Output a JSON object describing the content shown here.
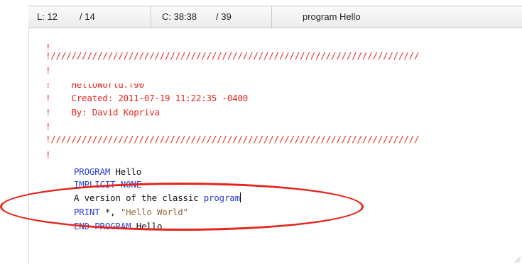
{
  "status_bar": {
    "line_label": "L: 12",
    "line_total": "/ 14",
    "col_label": "C: 38:38",
    "col_total": "/ 39",
    "symbol": "program Hello"
  },
  "editor": {
    "lines": {
      "l1": "!",
      "l2": "!///////////////////////////////////////////////////////////////////////",
      "l3": "!",
      "l4": "!    HelloWorld.f90",
      "l5": "!    Created: 2011-07-19 11:22:35 -0400",
      "l6": "!    By: David Kopriva",
      "l7": "!",
      "l8": "!///////////////////////////////////////////////////////////////////////",
      "l9": "!",
      "l10_kw": "PROGRAM",
      "l10_rest": " Hello",
      "l11": "IMPLICIT NONE",
      "l12_text": "A version of the classic ",
      "l12_kw": "program",
      "l13_kw": "PRINT",
      "l13_mid": " *, ",
      "l13_str": "\"Hello World\"",
      "l14_kw": "END PROGRAM",
      "l14_rest": " Hello"
    }
  },
  "colors": {
    "comment": "#e8281e",
    "keyword": "#2a3fd3",
    "string": "#946a3a",
    "annotation": "#e5251c"
  }
}
